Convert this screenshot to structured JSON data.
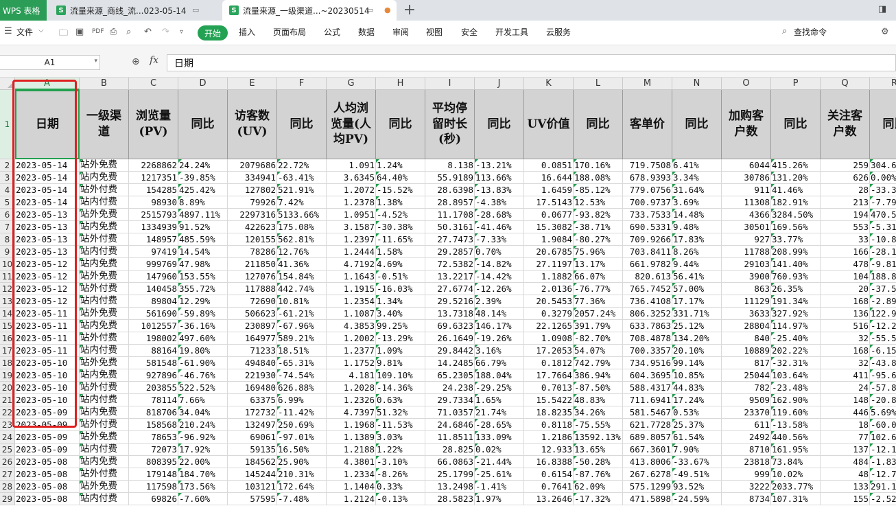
{
  "app": {
    "name": "WPS 表格",
    "brand_color": "#2b9d57"
  },
  "tabs": [
    {
      "label": "流量来源_商线_流...023-05-14",
      "active": false
    },
    {
      "label": "流量来源_一级渠道...~20230514",
      "active": true
    }
  ],
  "menu": {
    "file": "文件",
    "items": [
      "开始",
      "插入",
      "页面布局",
      "公式",
      "数据",
      "审阅",
      "视图",
      "安全",
      "开发工具",
      "云服务"
    ],
    "search": "查找命令"
  },
  "formula_bar": {
    "cell_ref": "A1",
    "fx": "fx",
    "content": "日期"
  },
  "columns": [
    "A",
    "B",
    "C",
    "D",
    "E",
    "F",
    "G",
    "H",
    "I",
    "J",
    "K",
    "L",
    "M",
    "N",
    "O",
    "P",
    "Q",
    "R"
  ],
  "headers": [
    "日期",
    "一级渠道",
    "浏览量(PV)",
    "同比",
    "访客数(UV)",
    "同比",
    "人均浏览量(人均PV)",
    "同比",
    "平均停留时长(秒)",
    "同比",
    "UV价值",
    "同比",
    "客单价",
    "同比",
    "加购客户数",
    "同比",
    "关注客户数",
    "同比"
  ],
  "rows": [
    [
      "2023-05-14",
      "站外免费",
      "2268862",
      "24.24%",
      "2079686",
      "22.72%",
      "1.091",
      "1.24%",
      "8.138",
      "-13.21%",
      "0.0851",
      "170.16%",
      "719.7508",
      "6.41%",
      "6044",
      "415.26%",
      "259",
      "304.6"
    ],
    [
      "2023-05-14",
      "站内免费",
      "1217351",
      "-39.85%",
      "334941",
      "-63.41%",
      "3.6345",
      "64.40%",
      "55.9189",
      "113.66%",
      "16.644",
      "188.08%",
      "678.9393",
      "3.34%",
      "30786",
      "131.20%",
      "626",
      "0.00%"
    ],
    [
      "2023-05-14",
      "站外付费",
      "154285",
      "425.42%",
      "127802",
      "521.91%",
      "1.2072",
      "-15.52%",
      "28.6398",
      "-13.83%",
      "1.6459",
      "-85.12%",
      "779.0756",
      "31.64%",
      "911",
      "41.46%",
      "28",
      "-33.3"
    ],
    [
      "2023-05-14",
      "站内付费",
      "98930",
      "8.89%",
      "79926",
      "7.42%",
      "1.2378",
      "1.38%",
      "28.8957",
      "-4.38%",
      "17.5143",
      "12.53%",
      "700.9737",
      "3.69%",
      "11308",
      "182.91%",
      "213",
      "-7.79"
    ],
    [
      "2023-05-13",
      "站外免费",
      "2515793",
      "4897.11%",
      "2297316",
      "5133.66%",
      "1.0951",
      "-4.52%",
      "11.1708",
      "-28.68%",
      "0.0677",
      "-93.82%",
      "733.7533",
      "14.48%",
      "4366",
      "3284.50%",
      "194",
      "470.5"
    ],
    [
      "2023-05-13",
      "站内免费",
      "1334939",
      "91.52%",
      "422623",
      "175.08%",
      "3.1587",
      "-30.38%",
      "50.3161",
      "-41.46%",
      "15.3082",
      "-38.71%",
      "690.5331",
      "9.48%",
      "30501",
      "169.56%",
      "553",
      "-5.31"
    ],
    [
      "2023-05-13",
      "站外付费",
      "148957",
      "485.59%",
      "120155",
      "562.81%",
      "1.2397",
      "-11.65%",
      "27.7473",
      "-7.33%",
      "1.9084",
      "-80.27%",
      "709.9266",
      "17.83%",
      "927",
      "33.77%",
      "33",
      "-10.8"
    ],
    [
      "2023-05-13",
      "站内付费",
      "97419",
      "14.54%",
      "78286",
      "12.76%",
      "1.2444",
      "1.58%",
      "29.2857",
      "0.70%",
      "20.6785",
      "75.96%",
      "703.8411",
      "8.26%",
      "11788",
      "208.99%",
      "166",
      "-28.1"
    ],
    [
      "2023-05-12",
      "站内免费",
      "999769",
      "47.98%",
      "211850",
      "41.36%",
      "4.7192",
      "4.69%",
      "72.5382",
      "-14.82%",
      "27.1197",
      "13.17%",
      "661.9782",
      "9.44%",
      "29103",
      "141.40%",
      "478",
      "-9.81"
    ],
    [
      "2023-05-12",
      "站外免费",
      "147960",
      "153.55%",
      "127076",
      "154.84%",
      "1.1643",
      "-0.51%",
      "13.2217",
      "-14.42%",
      "1.1882",
      "66.07%",
      "820.613",
      "56.41%",
      "3900",
      "760.93%",
      "104",
      "188.8"
    ],
    [
      "2023-05-12",
      "站外付费",
      "140458",
      "355.72%",
      "117888",
      "442.74%",
      "1.1915",
      "-16.03%",
      "27.6774",
      "-12.26%",
      "2.0136",
      "-76.77%",
      "765.7452",
      "57.00%",
      "863",
      "26.35%",
      "20",
      "-37.5"
    ],
    [
      "2023-05-12",
      "站内付费",
      "89804",
      "12.29%",
      "72690",
      "10.81%",
      "1.2354",
      "1.34%",
      "29.5216",
      "2.39%",
      "20.5453",
      "77.36%",
      "736.4108",
      "17.17%",
      "11129",
      "191.34%",
      "168",
      "-2.89"
    ],
    [
      "2023-05-11",
      "站外免费",
      "561690",
      "-59.89%",
      "506623",
      "-61.21%",
      "1.1087",
      "3.40%",
      "13.7318",
      "48.14%",
      "0.3279",
      "2057.24%",
      "806.3252",
      "331.71%",
      "3633",
      "327.92%",
      "136",
      "122.9"
    ],
    [
      "2023-05-11",
      "站内免费",
      "1012557",
      "-36.16%",
      "230897",
      "-67.96%",
      "4.3853",
      "99.25%",
      "69.6323",
      "146.17%",
      "22.1265",
      "391.79%",
      "633.7863",
      "25.12%",
      "28804",
      "114.97%",
      "516",
      "-12.2"
    ],
    [
      "2023-05-11",
      "站外付费",
      "198002",
      "497.60%",
      "164977",
      "589.21%",
      "1.2002",
      "-13.29%",
      "26.1649",
      "-19.26%",
      "1.0908",
      "-82.70%",
      "708.4878",
      "134.20%",
      "840",
      "-25.40%",
      "32",
      "-55.5"
    ],
    [
      "2023-05-11",
      "站内付费",
      "88164",
      "19.80%",
      "71233",
      "18.51%",
      "1.2377",
      "1.09%",
      "29.8442",
      "3.16%",
      "17.2053",
      "54.07%",
      "700.3357",
      "20.10%",
      "10889",
      "202.22%",
      "168",
      "-6.15"
    ],
    [
      "2023-05-10",
      "站外免费",
      "581548",
      "-61.90%",
      "494840",
      "-65.31%",
      "1.1752",
      "9.81%",
      "14.2485",
      "66.79%",
      "0.1812",
      "742.79%",
      "734.9516",
      "99.14%",
      "817",
      "-32.31%",
      "32",
      "-43.8"
    ],
    [
      "2023-05-10",
      "站内免费",
      "927896",
      "-46.76%",
      "221930",
      "-74.54%",
      "4.181",
      "109.10%",
      "65.2305",
      "188.04%",
      "17.7664",
      "386.94%",
      "604.3695",
      "10.85%",
      "25044",
      "103.64%",
      "411",
      "-95.6"
    ],
    [
      "2023-05-10",
      "站外付费",
      "203855",
      "522.52%",
      "169480",
      "626.88%",
      "1.2028",
      "-14.36%",
      "24.238",
      "-29.25%",
      "0.7013",
      "-87.50%",
      "588.4317",
      "44.83%",
      "782",
      "-23.48%",
      "24",
      "-57.8"
    ],
    [
      "2023-05-10",
      "站内付费",
      "78114",
      "7.66%",
      "63375",
      "6.99%",
      "1.2326",
      "0.63%",
      "29.7334",
      "1.65%",
      "15.5422",
      "48.83%",
      "711.6941",
      "17.24%",
      "9509",
      "162.90%",
      "148",
      "-20.8"
    ],
    [
      "2023-05-09",
      "站内免费",
      "818706",
      "34.04%",
      "172732",
      "-11.42%",
      "4.7397",
      "51.32%",
      "71.0357",
      "21.74%",
      "18.8235",
      "34.26%",
      "581.5467",
      "0.53%",
      "23370",
      "119.60%",
      "446",
      "5.69%"
    ],
    [
      "2023-05-09",
      "站外付费",
      "158568",
      "210.24%",
      "132497",
      "250.69%",
      "1.1968",
      "-11.53%",
      "24.6846",
      "-28.65%",
      "0.8118",
      "-75.55%",
      "621.7728",
      "25.37%",
      "611",
      "-13.58%",
      "18",
      "-60.0"
    ],
    [
      "2023-05-09",
      "站外免费",
      "78653",
      "-96.92%",
      "69061",
      "-97.01%",
      "1.1389",
      "3.03%",
      "11.8511",
      "133.09%",
      "1.2186",
      "13592.13%",
      "689.8057",
      "61.54%",
      "2492",
      "440.56%",
      "77",
      "102.6"
    ],
    [
      "2023-05-09",
      "站内付费",
      "72073",
      "17.92%",
      "59135",
      "16.50%",
      "1.2188",
      "1.22%",
      "28.825",
      "0.02%",
      "12.933",
      "13.65%",
      "667.3601",
      "7.90%",
      "8710",
      "161.95%",
      "137",
      "-12.1"
    ],
    [
      "2023-05-08",
      "站内免费",
      "808395",
      "22.00%",
      "184562",
      "25.90%",
      "4.3801",
      "-3.10%",
      "66.0863",
      "-21.44%",
      "16.8388",
      "-50.28%",
      "413.8006",
      "-33.67%",
      "23818",
      "73.84%",
      "484",
      "-1.83"
    ],
    [
      "2023-05-08",
      "站外付费",
      "179148",
      "184.70%",
      "145244",
      "210.31%",
      "1.2334",
      "-8.26%",
      "25.1799",
      "-25.61%",
      "0.6154",
      "-87.76%",
      "267.6278",
      "-49.51%",
      "999",
      "10.02%",
      "48",
      "-12.7"
    ],
    [
      "2023-05-08",
      "站外免费",
      "117598",
      "173.56%",
      "103121",
      "172.64%",
      "1.1404",
      "0.33%",
      "13.2498",
      "-1.41%",
      "0.7641",
      "62.09%",
      "575.1299",
      "93.52%",
      "3222",
      "2033.77%",
      "133",
      "291.1"
    ],
    [
      "2023-05-08",
      "站内付费",
      "69826",
      "-7.60%",
      "57595",
      "-7.48%",
      "1.2124",
      "-0.13%",
      "28.5823",
      "1.97%",
      "13.2646",
      "-17.32%",
      "471.5898",
      "-24.59%",
      "8734",
      "107.31%",
      "155",
      "-2.52"
    ]
  ]
}
